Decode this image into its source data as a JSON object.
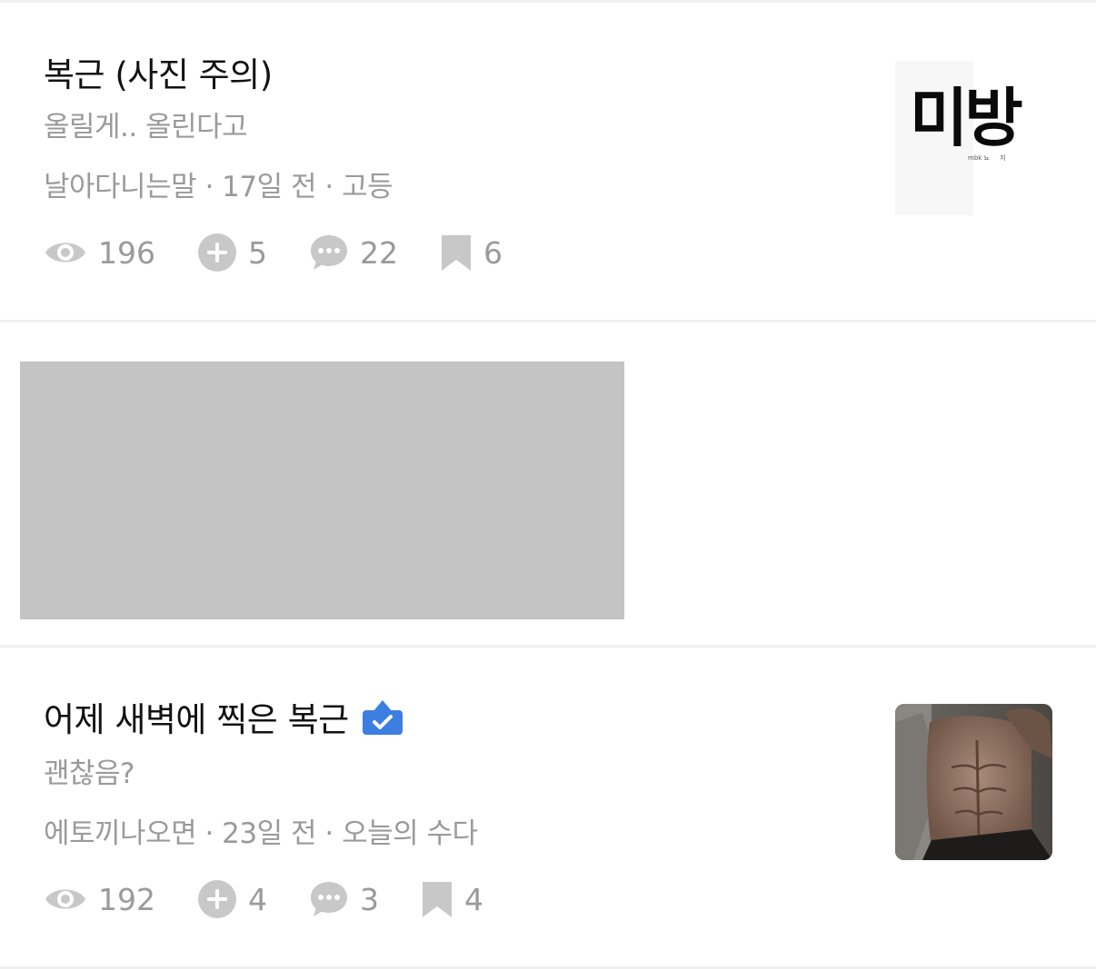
{
  "posts": [
    {
      "title": "복근 (사진 주의)",
      "subtitle": "올릴게.. 올린다고",
      "meta": "날아다니는말 · 17일 전 · 고등",
      "stats": {
        "views": "196",
        "likes": "5",
        "comments": "22",
        "bookmarks": "6"
      },
      "thumbnail": {
        "text": "미방",
        "small_text": "mbk 뇨     지",
        "kind": "text-image"
      }
    },
    {
      "title": "어제 새벽에 찍은 복근",
      "verified": true,
      "subtitle": "괜찮음?",
      "meta": "에토끼나오면 · 23일 전 · 오늘의 수다",
      "stats": {
        "views": "192",
        "likes": "4",
        "comments": "3",
        "bookmarks": "4"
      },
      "thumbnail": {
        "kind": "photo"
      }
    }
  ],
  "ad": {
    "kind": "blank-placeholder"
  },
  "icons": [
    "eye-icon",
    "plus-circle-icon",
    "comment-bubble-icon",
    "bookmark-icon",
    "verified-badge-icon"
  ],
  "colors": {
    "meta_gray": "#9a9a9a",
    "icon_gray": "#c8c8c8",
    "verified_blue": "#3d7fe0",
    "ad_gray": "#c4c4c4"
  }
}
